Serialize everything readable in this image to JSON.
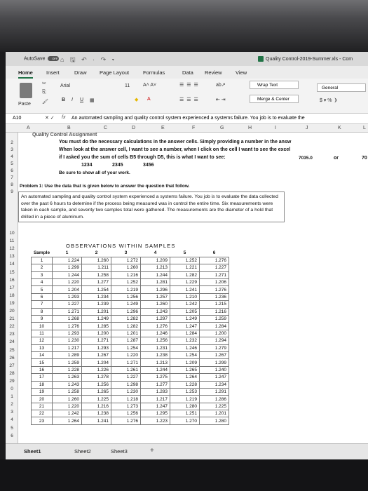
{
  "titlebar": {
    "autosave_label": "AutoSave",
    "autosave_state": "OFF",
    "quick_access": "⌂ 🖫 ↶ · ↷ ▾",
    "document_title": "Quality Control-2019-Summer.xls - Com"
  },
  "tabs": [
    "Home",
    "Insert",
    "Draw",
    "Page Layout",
    "Formulas",
    "Data",
    "Review",
    "View"
  ],
  "ribbon": {
    "paste_label": "Paste",
    "font_name": "Arial",
    "font_size": "11",
    "bold": "B",
    "italic": "I",
    "underline": "U",
    "wrap_text": "Wrap Text",
    "merge_center": "Merge & Center",
    "number_format": "General",
    "currency": "$ ▾ % ❩"
  },
  "formula_bar": {
    "cell_ref": "A10",
    "fx": "fx",
    "content": "An automated sampling and quality control system experienced a systems failure.  You job is to evaluate the"
  },
  "columns": [
    "A",
    "B",
    "C",
    "D",
    "E",
    "F",
    "G",
    "H",
    "I",
    "J",
    "K",
    "L"
  ],
  "rows_top": [
    "2",
    "3",
    "4",
    "5",
    "6",
    "7",
    "8",
    "9"
  ],
  "sheet": {
    "cut_title": "Quality Control Assignment",
    "line2": "You must do the necessary calculations in the answer cells.  Simply providing a number in the answ",
    "line3": "When look at the answer cell, I want to see a number, when I click on the cell I want to see the excel",
    "line4": "if I asked you the sum of cells B5 through D5, this is what I want to see:",
    "sum_value": "7035.0",
    "or_text": "or",
    "cut_right": "70",
    "v1": "1234",
    "v2": "2345",
    "v3": "3456",
    "line6": "Be sure to show all of your work.",
    "problem_title": "Problem 1:  Use the data that is given below to answer the question that follow.",
    "problem_text": "An automated sampling and quality control system experienced a systems failure.  You job is to evaluate the data collected over the past 6 hours to detemine if the process being measured was in control the entire time.  Six measurements were taken in each sample, and seventy two samples total were gathered.  The measurements are the diameter of a hold that drilled in a piece of aluminum."
  },
  "rows_bottom": [
    "10",
    "11",
    "12",
    "13",
    "14",
    "15",
    "16",
    "17",
    "18",
    "19",
    "20",
    "21",
    "22",
    "23",
    "24",
    "25",
    "26",
    "27",
    "28",
    "29",
    "0",
    "1",
    "2",
    "3",
    "4",
    "5",
    "6"
  ],
  "observations": {
    "title": "OBSERVATIONS WITHIN SAMPLES",
    "sample_header": "Sample",
    "col_headers": [
      "1",
      "2",
      "3",
      "4",
      "5",
      "6"
    ],
    "rows": [
      {
        "s": "1",
        "v": [
          "1.224",
          "1.260",
          "1.272",
          "1.209",
          "1.252",
          "1.276"
        ]
      },
      {
        "s": "2",
        "v": [
          "1.299",
          "1.211",
          "1.260",
          "1.213",
          "1.221",
          "1.227"
        ]
      },
      {
        "s": "3",
        "v": [
          "1.244",
          "1.258",
          "1.216",
          "1.244",
          "1.282",
          "1.271"
        ]
      },
      {
        "s": "4",
        "v": [
          "1.220",
          "1.277",
          "1.252",
          "1.281",
          "1.229",
          "1.206"
        ]
      },
      {
        "s": "5",
        "v": [
          "1.204",
          "1.254",
          "1.219",
          "1.296",
          "1.241",
          "1.276"
        ]
      },
      {
        "s": "6",
        "v": [
          "1.293",
          "1.234",
          "1.256",
          "1.257",
          "1.210",
          "1.236"
        ]
      },
      {
        "s": "7",
        "v": [
          "1.227",
          "1.239",
          "1.249",
          "1.260",
          "1.242",
          "1.215"
        ]
      },
      {
        "s": "8",
        "v": [
          "1.271",
          "1.201",
          "1.296",
          "1.243",
          "1.205",
          "1.216"
        ]
      },
      {
        "s": "9",
        "v": [
          "1.268",
          "1.249",
          "1.282",
          "1.297",
          "1.249",
          "1.259"
        ]
      },
      {
        "s": "10",
        "v": [
          "1.276",
          "1.285",
          "1.282",
          "1.276",
          "1.247",
          "1.284"
        ]
      },
      {
        "s": "11",
        "v": [
          "1.293",
          "1.200",
          "1.201",
          "1.246",
          "1.284",
          "1.200"
        ]
      },
      {
        "s": "12",
        "v": [
          "1.230",
          "1.271",
          "1.287",
          "1.256",
          "1.232",
          "1.294"
        ]
      },
      {
        "s": "13",
        "v": [
          "1.217",
          "1.293",
          "1.254",
          "1.231",
          "1.246",
          "1.279"
        ]
      },
      {
        "s": "14",
        "v": [
          "1.289",
          "1.267",
          "1.220",
          "1.238",
          "1.254",
          "1.267"
        ]
      },
      {
        "s": "15",
        "v": [
          "1.259",
          "1.204",
          "1.271",
          "1.213",
          "1.209",
          "1.299"
        ]
      },
      {
        "s": "16",
        "v": [
          "1.228",
          "1.226",
          "1.261",
          "1.244",
          "1.265",
          "1.240"
        ]
      },
      {
        "s": "17",
        "v": [
          "1.263",
          "1.278",
          "1.227",
          "1.275",
          "1.264",
          "1.247"
        ]
      },
      {
        "s": "18",
        "v": [
          "1.243",
          "1.256",
          "1.298",
          "1.277",
          "1.228",
          "1.234"
        ]
      },
      {
        "s": "19",
        "v": [
          "1.258",
          "1.265",
          "1.230",
          "1.283",
          "1.253",
          "1.291"
        ]
      },
      {
        "s": "20",
        "v": [
          "1.260",
          "1.225",
          "1.218",
          "1.217",
          "1.219",
          "1.286"
        ]
      },
      {
        "s": "21",
        "v": [
          "1.220",
          "1.216",
          "1.273",
          "1.247",
          "1.280",
          "1.225"
        ]
      },
      {
        "s": "22",
        "v": [
          "1.242",
          "1.238",
          "1.256",
          "1.295",
          "1.251",
          "1.201"
        ]
      },
      {
        "s": "23",
        "v": [
          "1.264",
          "1.241",
          "1.276",
          "1.223",
          "1.270",
          "1.280"
        ]
      }
    ]
  },
  "sheet_tabs": [
    "Sheet1",
    "Sheet2",
    "Sheet3"
  ],
  "add_sheet": "+"
}
